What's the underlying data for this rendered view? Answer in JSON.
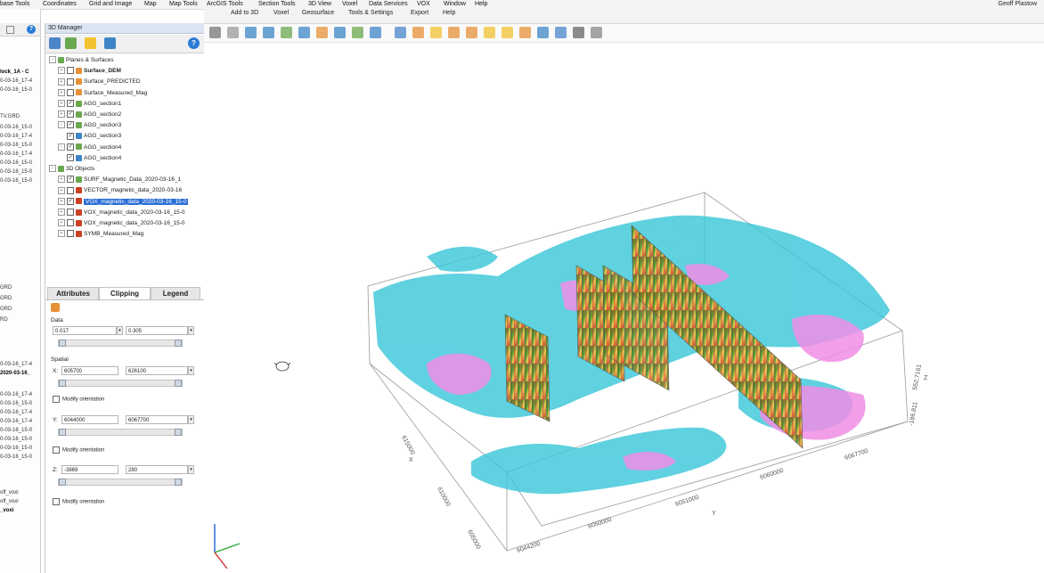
{
  "menu": {
    "items": [
      "base Tools",
      "Coordinates",
      "Grid and Image",
      "Map",
      "Map Tools",
      "ArcGIS Tools",
      "Section Tools",
      "3D View",
      "Voxel",
      "Data Services",
      "VOX",
      "Window",
      "Help"
    ],
    "user": "Geoff Plastow"
  },
  "toolbar": {
    "items": [
      "Add to 3D",
      "Voxel",
      "Geosurface",
      "Tools & Settings",
      "Export",
      "Help"
    ]
  },
  "left_panel": {
    "rows": [
      {
        "text": "lock_1A - C",
        "bold": true
      },
      {
        "text": "0-03-16_17-4",
        "bold": false
      },
      {
        "text": "0-03-16_15-0",
        "bold": false
      },
      {
        "text": "TV.GRD",
        "bold": false
      },
      {
        "text": "0-03-16_15-0",
        "bold": false
      },
      {
        "text": "0-03-16_17-4",
        "bold": false
      },
      {
        "text": "0-03-16_15-0",
        "bold": false
      },
      {
        "text": "0-03-16_17-4",
        "bold": false
      },
      {
        "text": "0-03-16_15-0",
        "bold": false
      },
      {
        "text": "0-03-16_15-0",
        "bold": false
      },
      {
        "text": "0-03-16_15-0",
        "bold": false
      },
      {
        "text": "GRD",
        "bold": false
      },
      {
        "text": "GRD",
        "bold": false
      },
      {
        "text": "GRD",
        "bold": false
      },
      {
        "text": "RD",
        "bold": false
      },
      {
        "text": "0-03-16_17-4",
        "bold": false
      },
      {
        "text": "2020-03-16_",
        "bold": true
      },
      {
        "text": "0-03-16_17-4",
        "bold": false
      },
      {
        "text": "0-03-16_15-0",
        "bold": false
      },
      {
        "text": "0-03-16_17-4",
        "bold": false
      },
      {
        "text": "0-03-16_17-4",
        "bold": false
      },
      {
        "text": "0-03-16_15-0",
        "bold": false
      },
      {
        "text": "0-03-16_15-0",
        "bold": false
      },
      {
        "text": "0-03-16_15-0",
        "bold": false
      },
      {
        "text": "0-03-16_15-0",
        "bold": false
      },
      {
        "text": "off_voxi",
        "bold": false
      },
      {
        "text": "off_voxi",
        "bold": false
      },
      {
        "text": "_voxi",
        "bold": true
      }
    ]
  },
  "manager": {
    "title": "3D Manager",
    "tree": [
      {
        "label": "Planes & Surfaces",
        "level": 0,
        "expanded": true,
        "checked": null,
        "icon": "#6aa84f",
        "bold": false,
        "selected": false
      },
      {
        "label": "Surface_DEM",
        "level": 1,
        "expanded": false,
        "checked": false,
        "icon": "#e69138",
        "bold": true,
        "selected": false
      },
      {
        "label": "Surface_PREDICTED",
        "level": 1,
        "expanded": false,
        "checked": false,
        "icon": "#e69138",
        "bold": false,
        "selected": false
      },
      {
        "label": "Surface_Measured_Mag",
        "level": 1,
        "expanded": false,
        "checked": false,
        "icon": "#e69138",
        "bold": false,
        "selected": false
      },
      {
        "label": "AGG_section1",
        "level": 1,
        "expanded": false,
        "checked": true,
        "icon": "#6aa84f",
        "bold": false,
        "selected": false
      },
      {
        "label": "AGG_section2",
        "level": 1,
        "expanded": false,
        "checked": true,
        "icon": "#6aa84f",
        "bold": false,
        "selected": false
      },
      {
        "label": "AGG_section3",
        "level": 1,
        "expanded": true,
        "checked": true,
        "icon": "#6aa84f",
        "bold": false,
        "selected": false
      },
      {
        "label": "AGG_section3",
        "level": 2,
        "expanded": null,
        "checked": true,
        "icon": "#3d85c6",
        "bold": false,
        "selected": false
      },
      {
        "label": "AGG_section4",
        "level": 1,
        "expanded": true,
        "checked": true,
        "icon": "#6aa84f",
        "bold": false,
        "selected": false
      },
      {
        "label": "AGG_section4",
        "level": 2,
        "expanded": null,
        "checked": true,
        "icon": "#3d85c6",
        "bold": false,
        "selected": false
      },
      {
        "label": "3D Objects",
        "level": 0,
        "expanded": true,
        "checked": null,
        "icon": "#6aa84f",
        "bold": false,
        "selected": false
      },
      {
        "label": "SURF_Magnetic_Data_2020-03-16_1",
        "level": 1,
        "expanded": false,
        "checked": true,
        "icon": "#6aa84f",
        "bold": false,
        "selected": false
      },
      {
        "label": "VECTOR_magnetic_data_2020-03-16",
        "level": 1,
        "expanded": false,
        "checked": false,
        "icon": "#cc4125",
        "bold": false,
        "selected": false
      },
      {
        "label": "VOX_magnetic_data_2020-03-16_15-0",
        "level": 1,
        "expanded": false,
        "checked": true,
        "icon": "#cc4125",
        "bold": false,
        "selected": true
      },
      {
        "label": "VOX_magnetic_data_2020-03-16_15-0",
        "level": 1,
        "expanded": false,
        "checked": false,
        "icon": "#cc4125",
        "bold": false,
        "selected": false
      },
      {
        "label": "VOX_magnetic_data_2020-03-16_15-0",
        "level": 1,
        "expanded": false,
        "checked": false,
        "icon": "#cc4125",
        "bold": false,
        "selected": false
      },
      {
        "label": "SYMB_Measured_Mag",
        "level": 1,
        "expanded": false,
        "checked": false,
        "icon": "#cc4125",
        "bold": false,
        "selected": false
      }
    ],
    "tabs": [
      "Attributes",
      "Clipping",
      "Legend"
    ],
    "active_tab": "Clipping",
    "clipping": {
      "data_label": "Data",
      "data_min": "0.017",
      "data_max": "0.305",
      "spatial_label": "Spatial",
      "x_label": "X:",
      "x_min": "605700",
      "x_max": "626100",
      "y_label": "Y:",
      "y_min": "6044000",
      "y_max": "6067700",
      "z_label": "Z:",
      "z_min": "-3869",
      "z_max": "280",
      "modify_orientation": "Modify orientation"
    }
  },
  "viewport": {
    "axis_x_label": "X",
    "axis_y_label": "Y",
    "axis_z_label": "Z",
    "x_ticks": [
      "615000",
      "610000",
      "605000"
    ],
    "y_ticks": [
      "6044200",
      "6050000",
      "6051000",
      "6060000",
      "6067700"
    ],
    "z_ticks": [
      "-186.811",
      "552,7161"
    ],
    "colors": {
      "cyan": "#38c6d8",
      "pink": "#f08ee6",
      "section_red": "#c0392b",
      "section_green": "#5a9a2a",
      "section_yellow": "#f2c94c"
    }
  }
}
